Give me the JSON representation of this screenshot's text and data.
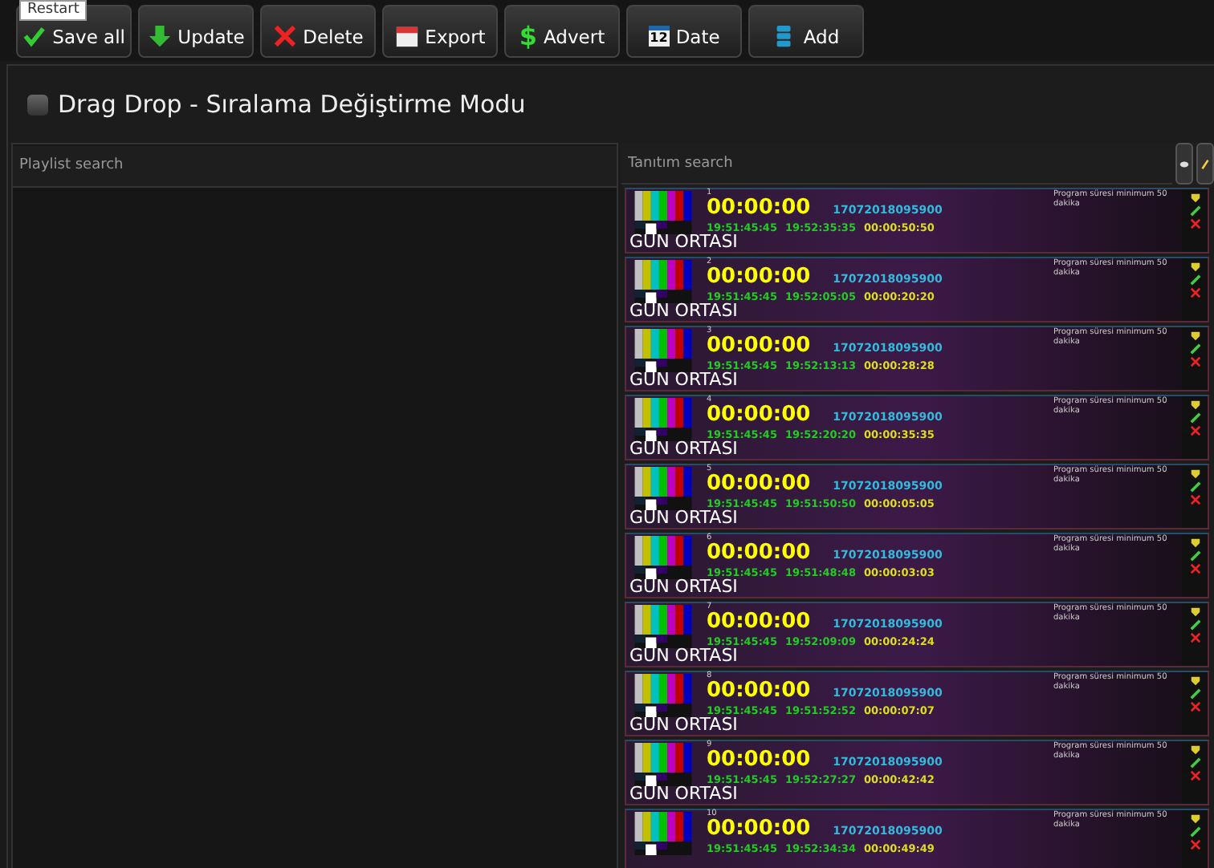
{
  "toolbar": [
    {
      "label": "Save all",
      "kind": "check"
    },
    {
      "label": "Update",
      "kind": "down"
    },
    {
      "label": "Delete",
      "kind": "cross"
    },
    {
      "label": "Export",
      "kind": "calendar"
    },
    {
      "label": "Advert",
      "kind": "dollar"
    },
    {
      "label": "Date",
      "kind": "date"
    },
    {
      "label": "Add",
      "kind": "stack"
    }
  ],
  "date_icon_text": "12",
  "dollar_icon_text": "$",
  "tooltip": "Restart",
  "mode": {
    "label": "Drag Drop - Sıralama Değiştirme Modu",
    "checked": false
  },
  "playlist": {
    "placeholder": "Playlist search"
  },
  "promos": {
    "placeholder": "Tanıtım search",
    "items": [
      {
        "number": "1",
        "duration": "00:00:00",
        "id": "17072018095900",
        "start": "19:51:45:45",
        "end": "19:52:35:35",
        "length": "00:00:50:50",
        "note": "Program süresi minimum 50 dakika",
        "title": "GÜN ORTASI"
      },
      {
        "number": "2",
        "duration": "00:00:00",
        "id": "17072018095900",
        "start": "19:51:45:45",
        "end": "19:52:05:05",
        "length": "00:00:20:20",
        "note": "Program süresi minimum 50 dakika",
        "title": "GÜN ORTASI"
      },
      {
        "number": "3",
        "duration": "00:00:00",
        "id": "17072018095900",
        "start": "19:51:45:45",
        "end": "19:52:13:13",
        "length": "00:00:28:28",
        "note": "Program süresi minimum 50 dakika",
        "title": "GÜN ORTASI"
      },
      {
        "number": "4",
        "duration": "00:00:00",
        "id": "17072018095900",
        "start": "19:51:45:45",
        "end": "19:52:20:20",
        "length": "00:00:35:35",
        "note": "Program süresi minimum 50 dakika",
        "title": "GÜN ORTASI"
      },
      {
        "number": "5",
        "duration": "00:00:00",
        "id": "17072018095900",
        "start": "19:51:45:45",
        "end": "19:51:50:50",
        "length": "00:00:05:05",
        "note": "Program süresi minimum 50 dakika",
        "title": "GÜN ORTASI"
      },
      {
        "number": "6",
        "duration": "00:00:00",
        "id": "17072018095900",
        "start": "19:51:45:45",
        "end": "19:51:48:48",
        "length": "00:00:03:03",
        "note": "Program süresi minimum 50 dakika",
        "title": "GÜN ORTASI"
      },
      {
        "number": "7",
        "duration": "00:00:00",
        "id": "17072018095900",
        "start": "19:51:45:45",
        "end": "19:52:09:09",
        "length": "00:00:24:24",
        "note": "Program süresi minimum 50 dakika",
        "title": "GÜN ORTASI"
      },
      {
        "number": "8",
        "duration": "00:00:00",
        "id": "17072018095900",
        "start": "19:51:45:45",
        "end": "19:51:52:52",
        "length": "00:00:07:07",
        "note": "Program süresi minimum 50 dakika",
        "title": "GÜN ORTASI"
      },
      {
        "number": "9",
        "duration": "00:00:00",
        "id": "17072018095900",
        "start": "19:51:45:45",
        "end": "19:52:27:27",
        "length": "00:00:42:42",
        "note": "Program süresi minimum 50 dakika",
        "title": "GÜN ORTASI"
      },
      {
        "number": "10",
        "duration": "00:00:00",
        "id": "17072018095900",
        "start": "19:51:45:45",
        "end": "19:52:34:34",
        "length": "00:00:49:49",
        "note": "Program süresi minimum 50 dakika"
      }
    ]
  }
}
